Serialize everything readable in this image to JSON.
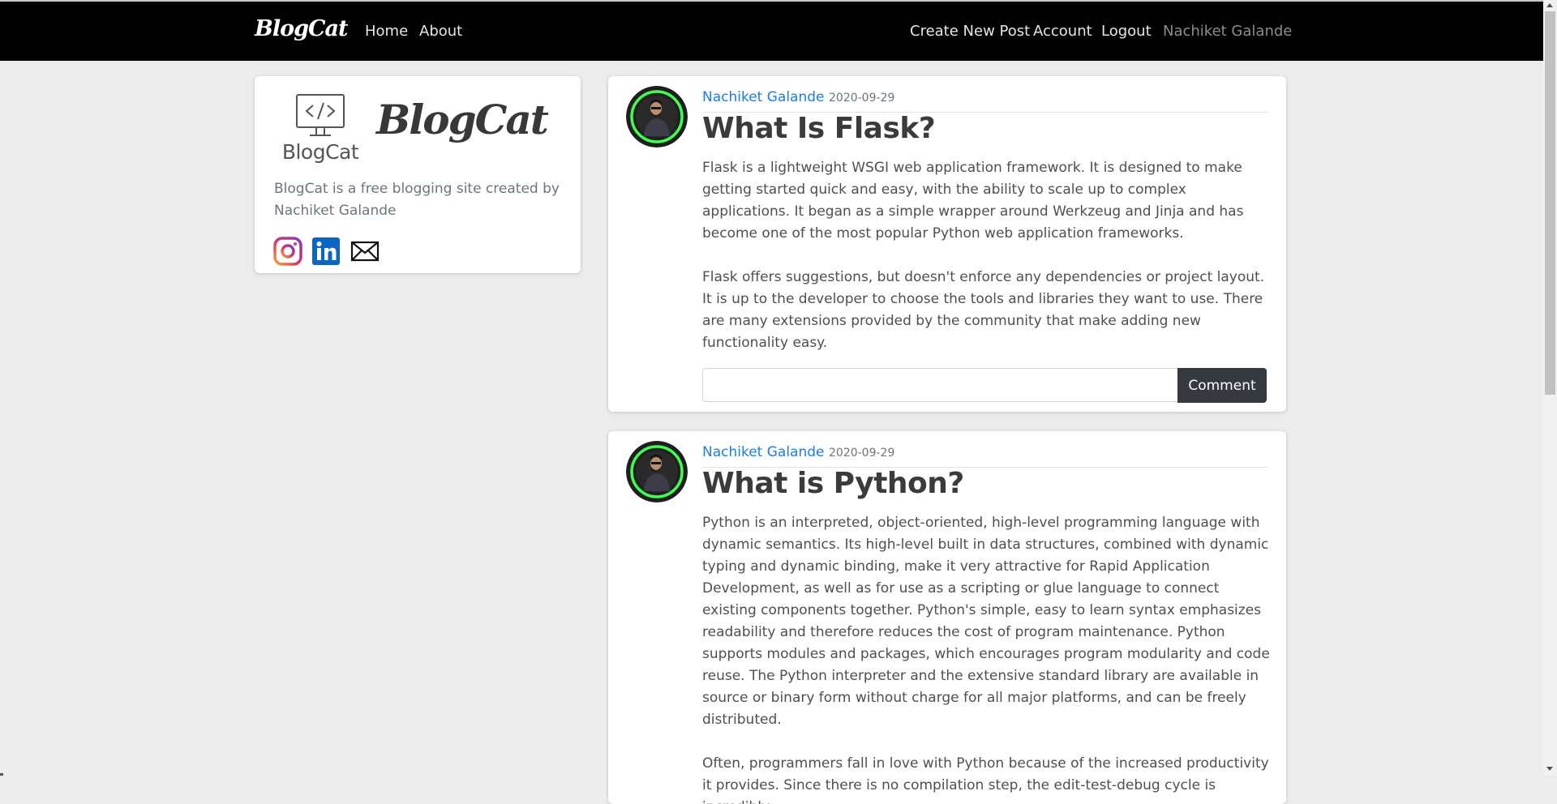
{
  "navbar": {
    "brand": "BlogCat",
    "links": {
      "home": "Home",
      "about": "About",
      "create": "Create New Post",
      "account": "Account",
      "logout": "Logout",
      "user": "Nachiket Galande"
    }
  },
  "sidebar": {
    "logo_text": "BlogCat",
    "title": "BlogCat",
    "description": "BlogCat is a free blogging site created by Nachiket Galande",
    "social_icons": [
      "instagram-icon",
      "linkedin-icon",
      "mail-icon"
    ]
  },
  "posts": [
    {
      "author": "Nachiket Galande",
      "date": "2020-09-29",
      "title": "What Is Flask?",
      "paragraphs": [
        "Flask is a lightweight WSGI web application framework. It is designed to make getting started quick and easy, with the ability to scale up to complex applications. It began as a simple wrapper around Werkzeug and Jinja and has become one of the most popular Python web application frameworks.",
        "Flask offers suggestions, but doesn't enforce any dependencies or project layout. It is up to the developer to choose the tools and libraries they want to use. There are many extensions provided by the community that make adding new functionality easy."
      ],
      "comment_value": "",
      "comment_button": "Comment"
    },
    {
      "author": "Nachiket Galande",
      "date": "2020-09-29",
      "title": "What is Python?",
      "paragraphs": [
        "Python is an interpreted, object-oriented, high-level programming language with dynamic semantics. Its high-level built in data structures, combined with dynamic typing and dynamic binding, make it very attractive for Rapid Application Development, as well as for use as a scripting or glue language to connect existing components together. Python's simple, easy to learn syntax emphasizes readability and therefore reduces the cost of program maintenance. Python supports modules and packages, which encourages program modularity and code reuse. The Python interpreter and the extensive standard library are available in source or binary form without charge for all major platforms, and can be freely distributed.",
        "Often, programmers fall in love with Python because of the increased productivity it provides. Since there is no compilation step, the edit-test-debug cycle is incredibly"
      ]
    }
  ],
  "colors": {
    "navbar_bg": "#000000",
    "page_bg": "#ececec",
    "author_link": "#1a7fe0",
    "button_bg": "#343a40"
  }
}
